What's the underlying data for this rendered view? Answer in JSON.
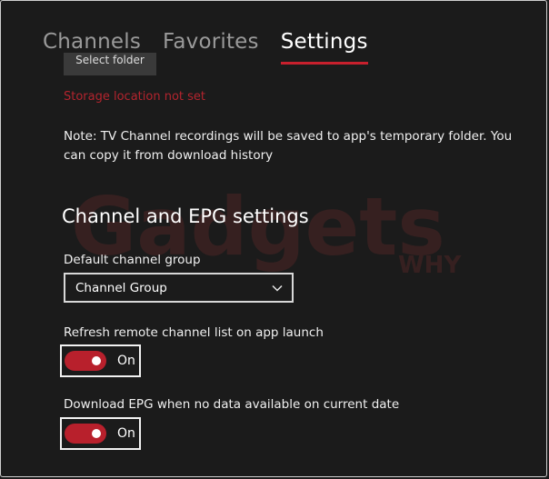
{
  "tabs": [
    {
      "label": "Channels",
      "active": false
    },
    {
      "label": "Favorites",
      "active": false
    },
    {
      "label": "Settings",
      "active": true
    }
  ],
  "storage": {
    "select_folder_label": "Select folder",
    "warning": "Storage location not set"
  },
  "note": "Note: TV Channel recordings will be saved to app's temporary folder. You can copy it from download history",
  "epg_section": {
    "heading": "Channel and EPG settings",
    "default_group": {
      "label": "Default channel group",
      "value": "Channel Group"
    },
    "refresh_setting": {
      "label": "Refresh remote channel list on app launch",
      "state_label": "On",
      "on": true
    },
    "download_setting": {
      "label": "Download EPG when no data available on current date",
      "state_label": "On",
      "on": true
    }
  },
  "watermark": {
    "brand": "Gadgets",
    "tag": "WHY"
  },
  "colors": {
    "background": "#1b1b1b",
    "accent": "#c8202d",
    "warning": "#b3242e"
  }
}
